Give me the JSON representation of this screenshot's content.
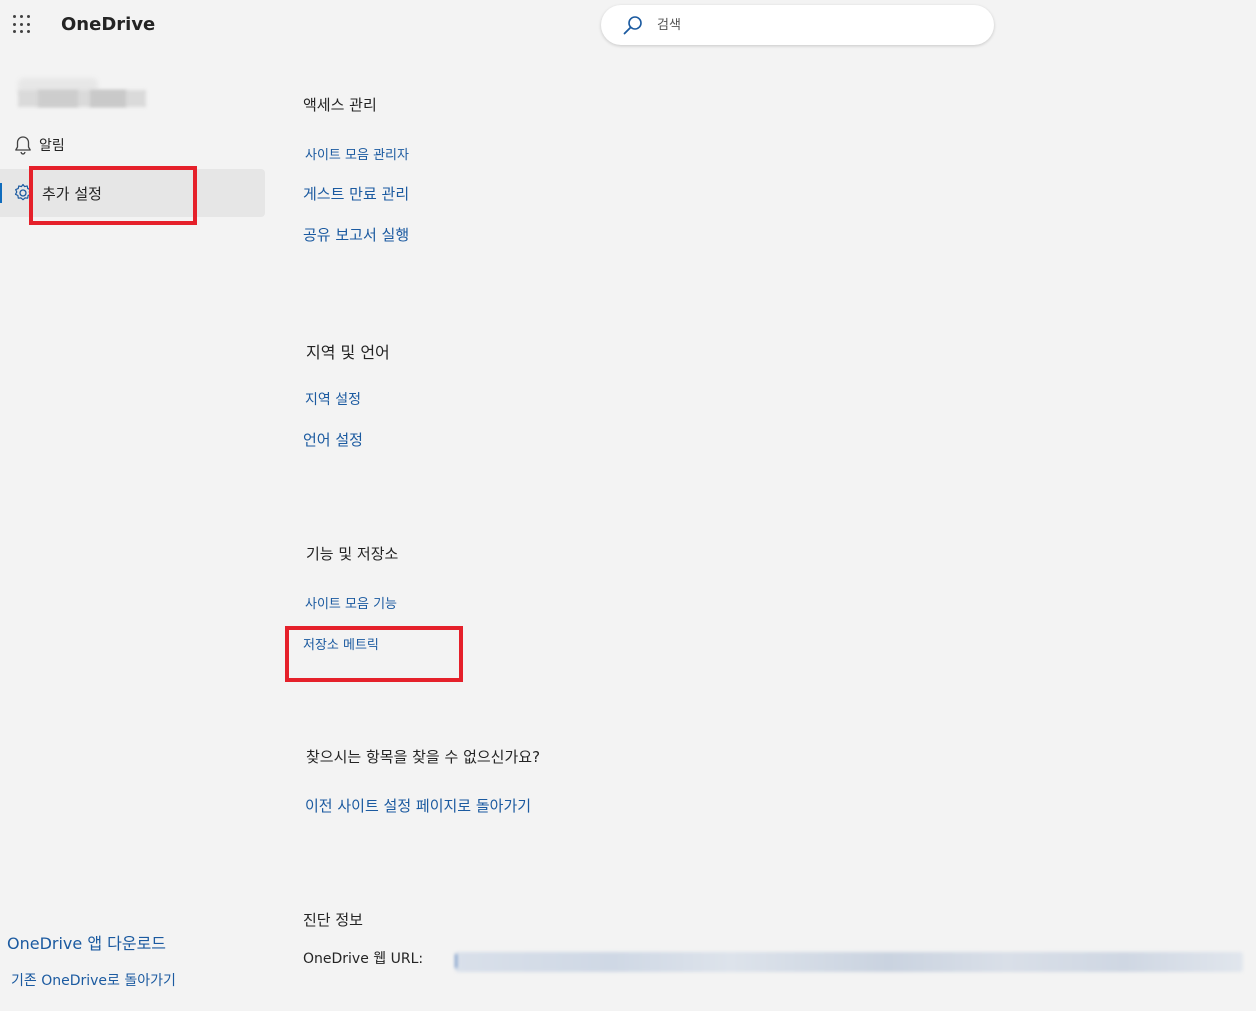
{
  "header": {
    "app_name": "OneDrive",
    "search_placeholder": "검색"
  },
  "sidebar": {
    "items": [
      {
        "label": "알림",
        "icon": "bell-icon"
      },
      {
        "label": "추가 설정",
        "icon": "gear-icon",
        "selected": true
      }
    ],
    "footer": {
      "download_label": "OneDrive 앱 다운로드",
      "back_label": "기존 OneDrive로 돌아가기"
    }
  },
  "main": {
    "access": {
      "title": "액세스 관리",
      "links": [
        "사이트 모음 관리자",
        "게스트 만료 관리",
        "공유 보고서 실행"
      ]
    },
    "region": {
      "title": "지역 및 언어",
      "links": [
        "지역 설정",
        "언어 설정"
      ]
    },
    "features": {
      "title": "기능 및 저장소",
      "links": [
        "사이트 모음 기능",
        "저장소 메트릭"
      ]
    },
    "notfound": {
      "title": "찾으시는 항목을 찾을 수 없으신가요?",
      "link": "이전 사이트 설정 페이지로 돌아가기"
    },
    "diagnostics": {
      "title": "진단 정보",
      "url_label": "OneDrive 웹 URL:"
    }
  },
  "colors": {
    "link": "#1b5aa0",
    "highlight_box": "#e5202a",
    "selected_nav": "#e6e6e6",
    "accent": "#0f6cbd"
  }
}
